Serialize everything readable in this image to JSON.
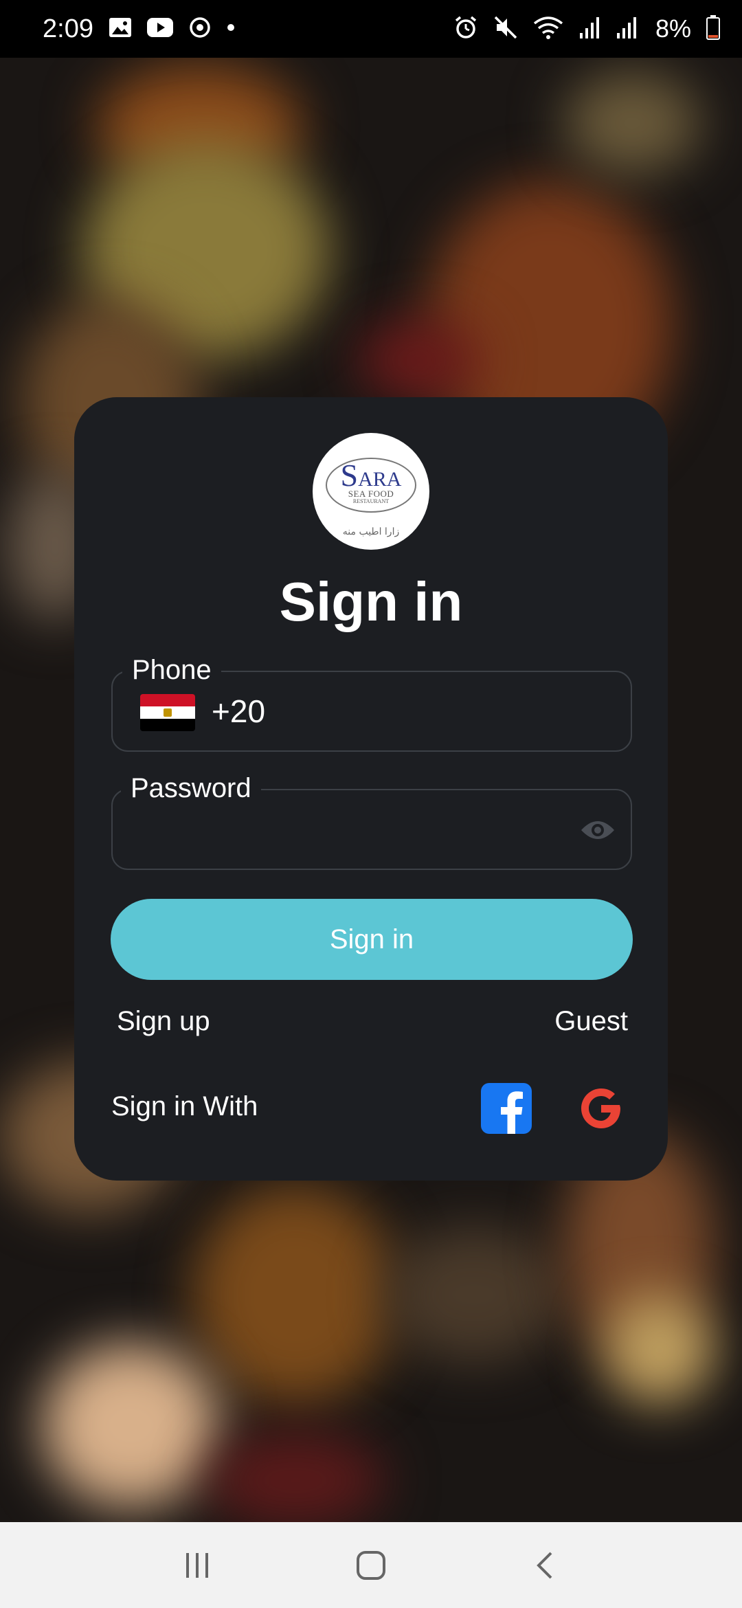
{
  "status_bar": {
    "time": "2:09",
    "battery": "8%",
    "left_icons": [
      "gallery-icon",
      "youtube-icon",
      "sync-icon",
      "dot-icon"
    ],
    "right_icons": [
      "alarm-icon",
      "mute-icon",
      "wifi-icon",
      "signal-icon",
      "signal-icon",
      "battery-icon"
    ]
  },
  "logo": {
    "brand_initial": "S",
    "brand_rest": "ARA",
    "line1": "SEA FOOD",
    "line2": "RESTAURANT",
    "tagline": "زارا اطيب منه"
  },
  "card": {
    "title": "Sign in"
  },
  "phone_field": {
    "label": "Phone",
    "dial_code": "+20",
    "country_flag": "egypt-flag-icon"
  },
  "password_field": {
    "label": "Password",
    "value": ""
  },
  "actions": {
    "signin_label": "Sign in",
    "signup_label": "Sign up",
    "guest_label": "Guest",
    "signin_with_label": "Sign in With"
  },
  "colors": {
    "accent": "#5cc6d4",
    "card_bg": "#1c1e22",
    "facebook": "#1877f2",
    "google": "#ea4335"
  }
}
